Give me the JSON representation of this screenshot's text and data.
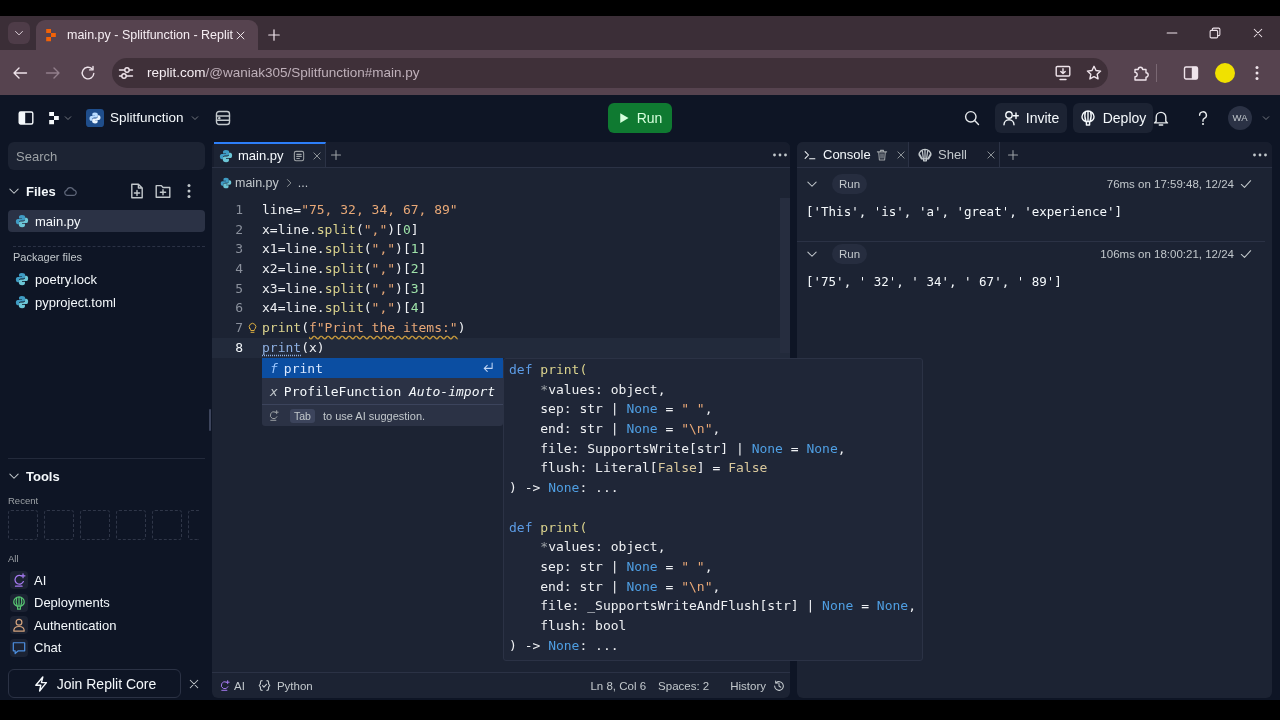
{
  "browser": {
    "tab": {
      "title": "main.py - Splitfunction - Replit",
      "selected": true
    },
    "navigation": [
      {
        "kind": "back",
        "disabled": false
      },
      {
        "kind": "forward",
        "disabled": true
      },
      {
        "kind": "reload",
        "disabled": false
      }
    ],
    "address": {
      "host": "replit.com",
      "path": "/@waniak305/Splitfunction#main.py"
    }
  },
  "header": {
    "project": "Splitfunction",
    "run": "Run",
    "invite": "Invite",
    "deploy": "Deploy",
    "avatar": "WA"
  },
  "sidebar": {
    "search": {
      "placeholder": "Search"
    },
    "files": {
      "title": "Files",
      "expanded": true,
      "items": [
        {
          "name": "main.py",
          "selected": true
        }
      ]
    },
    "packager_files": {
      "title": "Packager files",
      "items": [
        {
          "name": "poetry.lock",
          "selected": false
        },
        {
          "name": "pyproject.toml",
          "selected": false
        }
      ]
    },
    "tools": {
      "title": "Tools",
      "expanded": true,
      "recent_label": "Recent",
      "all_label": "All",
      "items": [
        {
          "kind": "ai",
          "label": "AI"
        },
        {
          "kind": "deployments",
          "label": "Deployments"
        },
        {
          "kind": "authentication",
          "label": "Authentication"
        },
        {
          "kind": "chat",
          "label": "Chat"
        }
      ]
    },
    "promo": {
      "label": "Join Replit Core"
    }
  },
  "editor": {
    "tabs": [
      {
        "label": "main.py",
        "selected": true
      }
    ],
    "breadcrumb": {
      "file": "main.py",
      "rest": "..."
    },
    "lines": [
      {
        "number": "1",
        "current": false,
        "hint": false,
        "tokens": [
          {
            "kind": "plain",
            "text": "line="
          },
          {
            "kind": "string",
            "text": "\"75, 32, 34, 67, 89\""
          }
        ]
      },
      {
        "number": "2",
        "current": false,
        "hint": false,
        "tokens": [
          {
            "kind": "plain",
            "text": "x=line."
          },
          {
            "kind": "function",
            "text": "split"
          },
          {
            "kind": "plain",
            "text": "("
          },
          {
            "kind": "string",
            "text": "\",\""
          },
          {
            "kind": "plain",
            "text": ")["
          },
          {
            "kind": "number",
            "text": "0"
          },
          {
            "kind": "plain",
            "text": "]"
          }
        ]
      },
      {
        "number": "3",
        "current": false,
        "hint": false,
        "tokens": [
          {
            "kind": "plain",
            "text": "x1=line."
          },
          {
            "kind": "function",
            "text": "split"
          },
          {
            "kind": "plain",
            "text": "("
          },
          {
            "kind": "string",
            "text": "\",\""
          },
          {
            "kind": "plain",
            "text": ")["
          },
          {
            "kind": "number",
            "text": "1"
          },
          {
            "kind": "plain",
            "text": "]"
          }
        ]
      },
      {
        "number": "4",
        "current": false,
        "hint": false,
        "tokens": [
          {
            "kind": "plain",
            "text": "x2=line."
          },
          {
            "kind": "function",
            "text": "split"
          },
          {
            "kind": "plain",
            "text": "("
          },
          {
            "kind": "string",
            "text": "\",\""
          },
          {
            "kind": "plain",
            "text": ")["
          },
          {
            "kind": "number",
            "text": "2"
          },
          {
            "kind": "plain",
            "text": "]"
          }
        ]
      },
      {
        "number": "5",
        "current": false,
        "hint": false,
        "tokens": [
          {
            "kind": "plain",
            "text": "x3=line."
          },
          {
            "kind": "function",
            "text": "split"
          },
          {
            "kind": "plain",
            "text": "("
          },
          {
            "kind": "string",
            "text": "\",\""
          },
          {
            "kind": "plain",
            "text": ")["
          },
          {
            "kind": "number",
            "text": "3"
          },
          {
            "kind": "plain",
            "text": "]"
          }
        ]
      },
      {
        "number": "6",
        "current": false,
        "hint": false,
        "tokens": [
          {
            "kind": "plain",
            "text": "x4=line."
          },
          {
            "kind": "function",
            "text": "split"
          },
          {
            "kind": "plain",
            "text": "("
          },
          {
            "kind": "string",
            "text": "\",\""
          },
          {
            "kind": "plain",
            "text": ")["
          },
          {
            "kind": "number",
            "text": "4"
          },
          {
            "kind": "plain",
            "text": "]"
          }
        ]
      },
      {
        "number": "7",
        "current": false,
        "hint": true,
        "tokens": [
          {
            "kind": "function",
            "text": "print"
          },
          {
            "kind": "plain",
            "text": "("
          },
          {
            "kind": "flagged",
            "text": "f\"Print the items:\""
          },
          {
            "kind": "plain",
            "text": ")"
          }
        ]
      },
      {
        "number": "8",
        "current": true,
        "hint": false,
        "tokens": [
          {
            "kind": "match",
            "text": "print"
          },
          {
            "kind": "plain",
            "text": "(x)"
          }
        ]
      }
    ],
    "autocomplete": {
      "items": [
        {
          "kind": "function",
          "symbol": "f",
          "label": "print",
          "selected": true
        },
        {
          "kind": "variable",
          "symbol": "x",
          "label": "ProfileFunction",
          "detail": "Auto-import",
          "selected": false
        }
      ],
      "hint": {
        "key": "Tab",
        "text": "to use AI suggestion."
      }
    },
    "hover_doc": {
      "signatures": [
        {
          "lines": [
            {
              "indented": false,
              "tokens": [
                {
                  "kind": "keyword",
                  "text": "def"
                },
                {
                  "kind": "function",
                  "text": " print("
                }
              ]
            },
            {
              "indented": true,
              "tokens": [
                {
                  "kind": "dim",
                  "text": "*"
                },
                {
                  "kind": "plain",
                  "text": "values: object,"
                }
              ]
            },
            {
              "indented": true,
              "tokens": [
                {
                  "kind": "plain",
                  "text": "sep: str | "
                },
                {
                  "kind": "constant",
                  "text": "None"
                },
                {
                  "kind": "plain",
                  "text": " = "
                },
                {
                  "kind": "string",
                  "text": "\" \""
                },
                {
                  "kind": "plain",
                  "text": ","
                }
              ]
            },
            {
              "indented": true,
              "tokens": [
                {
                  "kind": "plain",
                  "text": "end: str | "
                },
                {
                  "kind": "constant",
                  "text": "None"
                },
                {
                  "kind": "plain",
                  "text": " = "
                },
                {
                  "kind": "string",
                  "text": "\"\\n\""
                },
                {
                  "kind": "plain",
                  "text": ","
                }
              ]
            },
            {
              "indented": true,
              "tokens": [
                {
                  "kind": "plain",
                  "text": "file: SupportsWrite[str] | "
                },
                {
                  "kind": "constant",
                  "text": "None"
                },
                {
                  "kind": "plain",
                  "text": " = "
                },
                {
                  "kind": "constant",
                  "text": "None"
                },
                {
                  "kind": "plain",
                  "text": ","
                }
              ]
            },
            {
              "indented": true,
              "tokens": [
                {
                  "kind": "plain",
                  "text": "flush: Literal["
                },
                {
                  "kind": "boolean",
                  "text": "False"
                },
                {
                  "kind": "plain",
                  "text": "] = "
                },
                {
                  "kind": "boolean",
                  "text": "False"
                }
              ]
            },
            {
              "indented": false,
              "tokens": [
                {
                  "kind": "plain",
                  "text": ") -> "
                },
                {
                  "kind": "constant",
                  "text": "None"
                },
                {
                  "kind": "plain",
                  "text": ": ..."
                }
              ]
            }
          ]
        },
        {
          "lines": [
            {
              "indented": false,
              "tokens": [
                {
                  "kind": "keyword",
                  "text": "def"
                },
                {
                  "kind": "function",
                  "text": " print("
                }
              ]
            },
            {
              "indented": true,
              "tokens": [
                {
                  "kind": "dim",
                  "text": "*"
                },
                {
                  "kind": "plain",
                  "text": "values: object,"
                }
              ]
            },
            {
              "indented": true,
              "tokens": [
                {
                  "kind": "plain",
                  "text": "sep: str | "
                },
                {
                  "kind": "constant",
                  "text": "None"
                },
                {
                  "kind": "plain",
                  "text": " = "
                },
                {
                  "kind": "string",
                  "text": "\" \""
                },
                {
                  "kind": "plain",
                  "text": ","
                }
              ]
            },
            {
              "indented": true,
              "tokens": [
                {
                  "kind": "plain",
                  "text": "end: str | "
                },
                {
                  "kind": "constant",
                  "text": "None"
                },
                {
                  "kind": "plain",
                  "text": " = "
                },
                {
                  "kind": "string",
                  "text": "\"\\n\""
                },
                {
                  "kind": "plain",
                  "text": ","
                }
              ]
            },
            {
              "indented": true,
              "tokens": [
                {
                  "kind": "plain",
                  "text": "file: _SupportsWriteAndFlush[str] | "
                },
                {
                  "kind": "constant",
                  "text": "None"
                },
                {
                  "kind": "plain",
                  "text": " = "
                },
                {
                  "kind": "constant",
                  "text": "None"
                },
                {
                  "kind": "plain",
                  "text": ","
                }
              ]
            },
            {
              "indented": true,
              "tokens": [
                {
                  "kind": "plain",
                  "text": "flush: bool"
                }
              ]
            },
            {
              "indented": false,
              "tokens": [
                {
                  "kind": "plain",
                  "text": ") -> "
                },
                {
                  "kind": "constant",
                  "text": "None"
                },
                {
                  "kind": "plain",
                  "text": ": ..."
                }
              ]
            }
          ]
        }
      ]
    },
    "status_bar": {
      "ai": "AI",
      "language": "Python",
      "cursor": "Ln 8, Col 6",
      "indent": "Spaces: 2",
      "history": "History"
    }
  },
  "console": {
    "tabs": [
      {
        "kind": "console",
        "label": "Console",
        "selected": true
      },
      {
        "kind": "shell",
        "label": "Shell",
        "selected": false
      }
    ],
    "entries": [
      {
        "label": "Run",
        "timing": "76ms on 17:59:48, 12/24",
        "succeeded": true,
        "expanded": true,
        "output": "['This', 'is', 'a', 'great', 'experience']"
      },
      {
        "label": "Run",
        "timing": "106ms on 18:00:21, 12/24",
        "succeeded": true,
        "expanded": true,
        "output": "['75', ' 32', ' 34', ' 67', ' 89']"
      }
    ]
  }
}
